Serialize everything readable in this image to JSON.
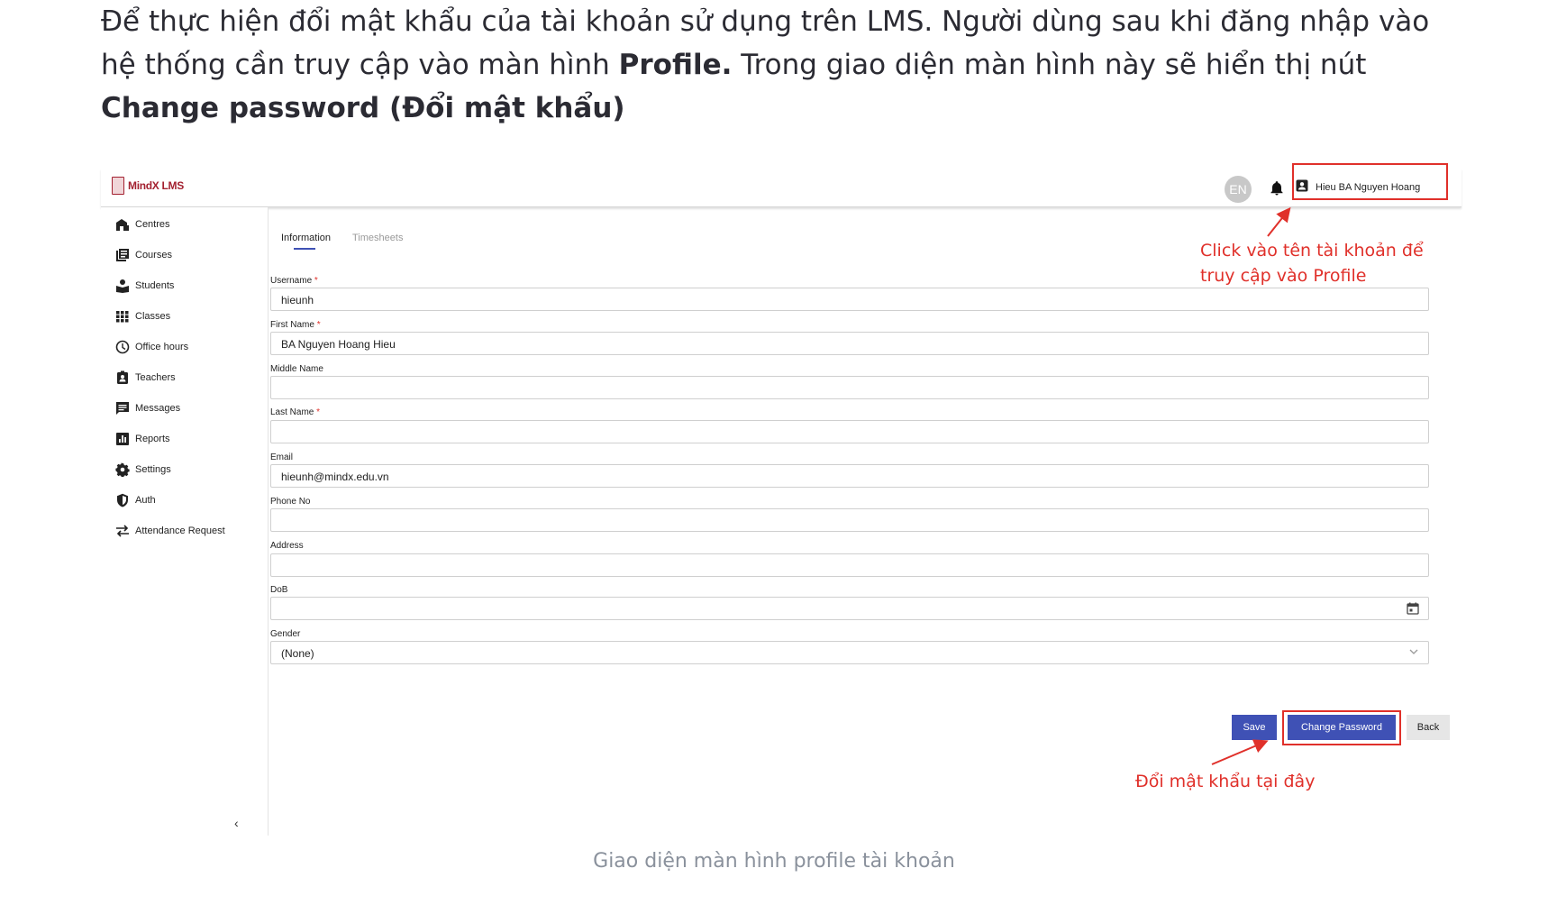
{
  "intro": {
    "part1": "Để thực hiện đổi mật khẩu của tài khoản sử dụng trên LMS. Người dùng sau khi đăng nhập vào hệ thống cần truy cập vào màn hình ",
    "bold1": "Profile.",
    "part2": " Trong giao diện màn hình này sẽ hiển thị nút ",
    "bold2": "Change password (Đổi mật khẩu)"
  },
  "app": {
    "logo_text": "MindX LMS",
    "lang_badge": "EN",
    "user_name": "Hieu BA Nguyen Hoang"
  },
  "sidebar": {
    "items": [
      {
        "label": "Centres",
        "icon": "home-building-icon"
      },
      {
        "label": "Courses",
        "icon": "courses-icon"
      },
      {
        "label": "Students",
        "icon": "students-icon"
      },
      {
        "label": "Classes",
        "icon": "grid-icon"
      },
      {
        "label": "Office hours",
        "icon": "clock-icon"
      },
      {
        "label": "Teachers",
        "icon": "badge-icon"
      },
      {
        "label": "Messages",
        "icon": "message-icon"
      },
      {
        "label": "Reports",
        "icon": "report-icon"
      },
      {
        "label": "Settings",
        "icon": "gear-icon"
      },
      {
        "label": "Auth",
        "icon": "shield-icon"
      },
      {
        "label": "Attendance Request",
        "icon": "swap-icon"
      }
    ],
    "collapse_glyph": "‹"
  },
  "tabs": {
    "information": "Information",
    "timesheets": "Timesheets"
  },
  "form": {
    "username_label": "Username",
    "username_value": "hieunh",
    "first_name_label": "First Name",
    "first_name_value": "BA Nguyen Hoang Hieu",
    "middle_name_label": "Middle Name",
    "middle_name_value": "",
    "last_name_label": "Last Name",
    "last_name_value": "",
    "email_label": "Email",
    "email_value": "hieunh@mindx.edu.vn",
    "phone_label": "Phone No",
    "phone_value": "",
    "address_label": "Address",
    "address_value": "",
    "dob_label": "DoB",
    "dob_value": "",
    "gender_label": "Gender",
    "gender_value": "(None)",
    "required_mark": "*"
  },
  "buttons": {
    "save": "Save",
    "change_password": "Change Password",
    "back": "Back"
  },
  "annotations": {
    "profile_line1": "Click vào tên tài khoản để",
    "profile_line2": "truy cập vào Profile",
    "change_password": "Đổi mật khẩu tại đây"
  },
  "caption": "Giao diện màn hình profile tài khoản",
  "colors": {
    "primary": "#3f51b5",
    "annotation": "#e0302a",
    "brand": "#a32130"
  }
}
